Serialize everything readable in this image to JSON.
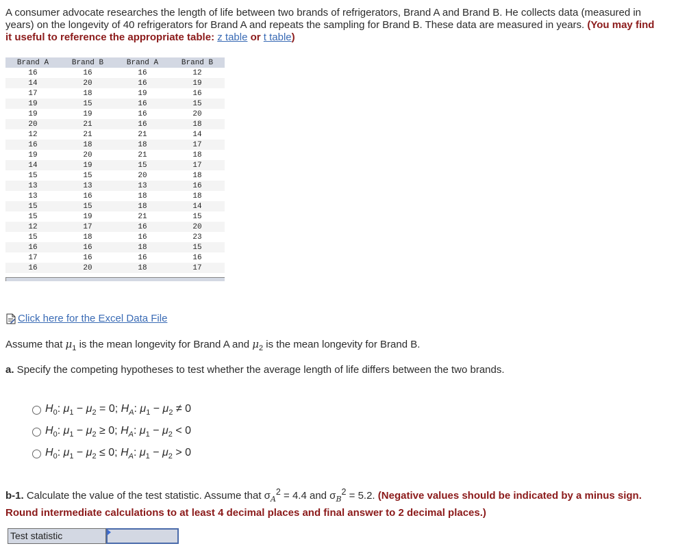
{
  "intro": {
    "text": "A consumer advocate researches the length of life between two brands of refrigerators, Brand A and Brand B. He collects data (measured in years) on the longevity of 40 refrigerators for Brand A and repeats the sampling for Brand B. These data are measured in years.",
    "hint_prefix": "(You may find it useful to reference the appropriate table:",
    "z_table_link": "z table",
    "or": "or",
    "t_table_link": "t table",
    "hint_suffix": ")"
  },
  "table": {
    "headers": [
      "Brand A",
      "Brand B",
      "Brand A",
      "Brand B"
    ],
    "rows": [
      [
        "16",
        "16",
        "16",
        "12"
      ],
      [
        "14",
        "20",
        "16",
        "19"
      ],
      [
        "17",
        "18",
        "19",
        "16"
      ],
      [
        "19",
        "15",
        "16",
        "15"
      ],
      [
        "19",
        "19",
        "16",
        "20"
      ],
      [
        "20",
        "21",
        "16",
        "18"
      ],
      [
        "12",
        "21",
        "21",
        "14"
      ],
      [
        "16",
        "18",
        "18",
        "17"
      ],
      [
        "19",
        "20",
        "21",
        "18"
      ],
      [
        "14",
        "19",
        "15",
        "17"
      ],
      [
        "15",
        "15",
        "20",
        "18"
      ],
      [
        "13",
        "13",
        "13",
        "16"
      ],
      [
        "13",
        "16",
        "18",
        "18"
      ],
      [
        "15",
        "15",
        "18",
        "14"
      ],
      [
        "15",
        "19",
        "21",
        "15"
      ],
      [
        "12",
        "17",
        "16",
        "20"
      ],
      [
        "15",
        "18",
        "16",
        "23"
      ],
      [
        "16",
        "16",
        "18",
        "15"
      ],
      [
        "17",
        "16",
        "16",
        "16"
      ],
      [
        "16",
        "20",
        "18",
        "17"
      ]
    ]
  },
  "excel_link": {
    "icon": "file-icon",
    "label": "Click here for the Excel Data File"
  },
  "assume": {
    "p1": "Assume that ",
    "mu1": "μ",
    "sub1": "1",
    "p2": " is the mean longevity for Brand A and ",
    "mu2": "μ",
    "sub2": "2",
    "p3": " is the mean longevity for Brand B."
  },
  "question_a": {
    "label": "a.",
    "text": " Specify the competing hypotheses to test whether the average length of life differs between the two brands.",
    "options": [
      {
        "h0_rel": "=",
        "ha_rel": "≠"
      },
      {
        "h0_rel": "≥",
        "ha_rel": "<"
      },
      {
        "h0_rel": "≤",
        "ha_rel": ">"
      }
    ],
    "h0": "H",
    "h0_sub": "0",
    "ha": "H",
    "ha_sub": "A",
    "diff": "μ1 − μ2"
  },
  "question_b1": {
    "label": "b-1.",
    "text1": " Calculate the value of the test statistic. Assume that σ",
    "sub_a": "A",
    "sup": "2",
    "eq_a": " = 4.4 and σ",
    "sub_b": "B",
    "eq_b": " = 5.2. ",
    "instruction": "(Negative values should be indicated by a minus sign. Round intermediate calculations to at least 4 decimal places and final answer to 2 decimal places.)"
  },
  "answer": {
    "label": "Test statistic",
    "value": ""
  }
}
